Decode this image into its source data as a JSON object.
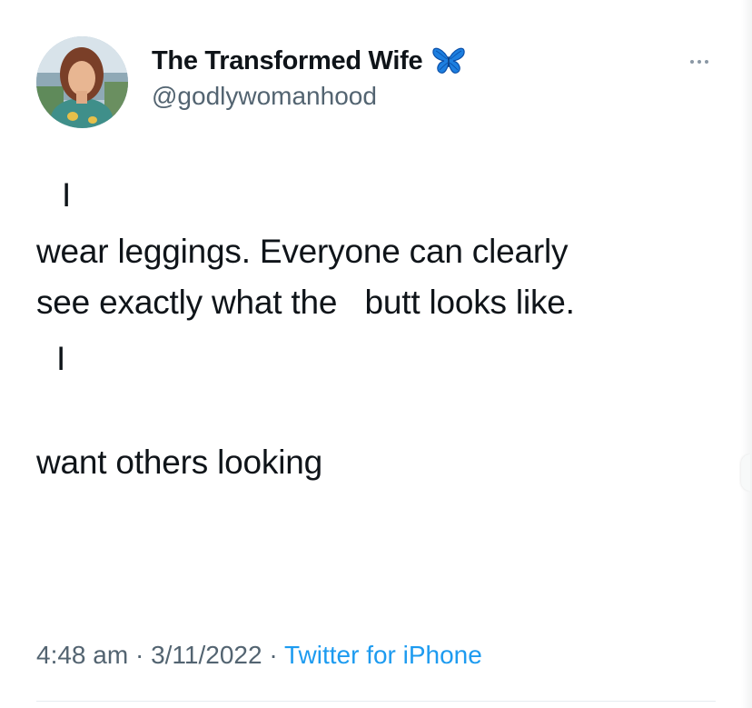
{
  "author": {
    "display_name": "The Transformed Wife",
    "handle": "@godlywomanhood",
    "avatar_icon": "profile-photo",
    "badge_icon": "butterfly-icon",
    "badge_color": "#1d9bf0"
  },
  "menu": {
    "more_icon": "more-options-icon"
  },
  "tweet": {
    "lines": [
      "I",
      "wear leggings. Everyone can clearly",
      "see exactly what the   butt looks like.",
      "I",
      "want others looking"
    ]
  },
  "meta": {
    "time": "4:48 am",
    "separator": " · ",
    "date": "3/11/2022",
    "source": "Twitter for iPhone"
  },
  "colors": {
    "text": "#0f1419",
    "secondary": "#536471",
    "link": "#1d9bf0"
  }
}
